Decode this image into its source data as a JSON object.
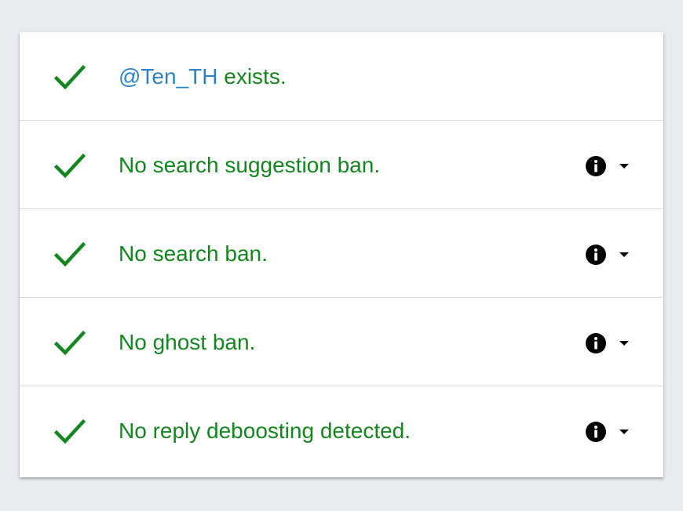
{
  "results": {
    "exists": {
      "handle": "@Ten_TH",
      "suffix": " exists."
    },
    "rows": [
      {
        "label": "No search suggestion ban."
      },
      {
        "label": "No search ban."
      },
      {
        "label": "No ghost ban."
      },
      {
        "label": "No reply deboosting detected."
      }
    ]
  },
  "colors": {
    "success_green": "#14861f",
    "handle_blue": "#2b82c6",
    "background": "#e8ecf1"
  },
  "icons": {
    "check": "check-icon",
    "info": "info-icon",
    "expand": "caret-down-icon"
  }
}
